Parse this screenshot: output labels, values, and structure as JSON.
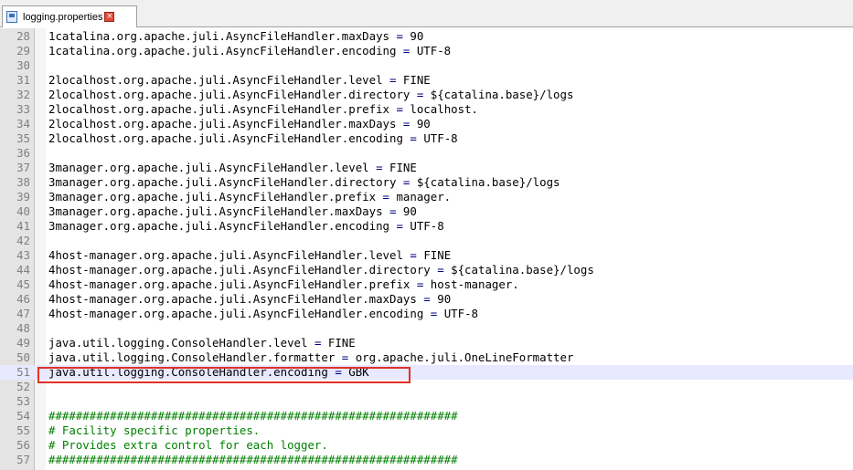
{
  "tab": {
    "label": "logging.properties",
    "close_symbol": "×",
    "icon": "properties-file-icon"
  },
  "colors": {
    "operator": "#000080",
    "comment": "#008000",
    "line_number": "#808080",
    "annotation_box": "#e0302a",
    "current_line": "#e8e8ff"
  },
  "editor": {
    "current_line": 51,
    "lines": [
      {
        "n": "28",
        "key": "1catalina.org.apache.juli.AsyncFileHandler.maxDays",
        "value": "90"
      },
      {
        "n": "29",
        "key": "1catalina.org.apache.juli.AsyncFileHandler.encoding",
        "value": "UTF-8"
      },
      {
        "n": "30",
        "blank": true
      },
      {
        "n": "31",
        "key": "2localhost.org.apache.juli.AsyncFileHandler.level",
        "value": "FINE"
      },
      {
        "n": "32",
        "key": "2localhost.org.apache.juli.AsyncFileHandler.directory",
        "value": "${catalina.base}/logs"
      },
      {
        "n": "33",
        "key": "2localhost.org.apache.juli.AsyncFileHandler.prefix",
        "value": "localhost."
      },
      {
        "n": "34",
        "key": "2localhost.org.apache.juli.AsyncFileHandler.maxDays",
        "value": "90"
      },
      {
        "n": "35",
        "key": "2localhost.org.apache.juli.AsyncFileHandler.encoding",
        "value": "UTF-8"
      },
      {
        "n": "36",
        "blank": true
      },
      {
        "n": "37",
        "key": "3manager.org.apache.juli.AsyncFileHandler.level",
        "value": "FINE"
      },
      {
        "n": "38",
        "key": "3manager.org.apache.juli.AsyncFileHandler.directory",
        "value": "${catalina.base}/logs"
      },
      {
        "n": "39",
        "key": "3manager.org.apache.juli.AsyncFileHandler.prefix",
        "value": "manager."
      },
      {
        "n": "40",
        "key": "3manager.org.apache.juli.AsyncFileHandler.maxDays",
        "value": "90"
      },
      {
        "n": "41",
        "key": "3manager.org.apache.juli.AsyncFileHandler.encoding",
        "value": "UTF-8"
      },
      {
        "n": "42",
        "blank": true
      },
      {
        "n": "43",
        "key": "4host-manager.org.apache.juli.AsyncFileHandler.level",
        "value": "FINE"
      },
      {
        "n": "44",
        "key": "4host-manager.org.apache.juli.AsyncFileHandler.directory",
        "value": "${catalina.base}/logs"
      },
      {
        "n": "45",
        "key": "4host-manager.org.apache.juli.AsyncFileHandler.prefix",
        "value": "host-manager."
      },
      {
        "n": "46",
        "key": "4host-manager.org.apache.juli.AsyncFileHandler.maxDays",
        "value": "90"
      },
      {
        "n": "47",
        "key": "4host-manager.org.apache.juli.AsyncFileHandler.encoding",
        "value": "UTF-8"
      },
      {
        "n": "48",
        "blank": true
      },
      {
        "n": "49",
        "key": "java.util.logging.ConsoleHandler.level",
        "value": "FINE"
      },
      {
        "n": "50",
        "key": "java.util.logging.ConsoleHandler.formatter",
        "value": "org.apache.juli.OneLineFormatter"
      },
      {
        "n": "51",
        "key": "java.util.logging.ConsoleHandler.encoding",
        "value": "GBK"
      },
      {
        "n": "52",
        "blank": true
      },
      {
        "n": "53",
        "blank": true
      },
      {
        "n": "54",
        "comment": "############################################################"
      },
      {
        "n": "55",
        "comment": "# Facility specific properties."
      },
      {
        "n": "56",
        "comment": "# Provides extra control for each logger."
      },
      {
        "n": "57",
        "comment": "############################################################"
      }
    ]
  }
}
